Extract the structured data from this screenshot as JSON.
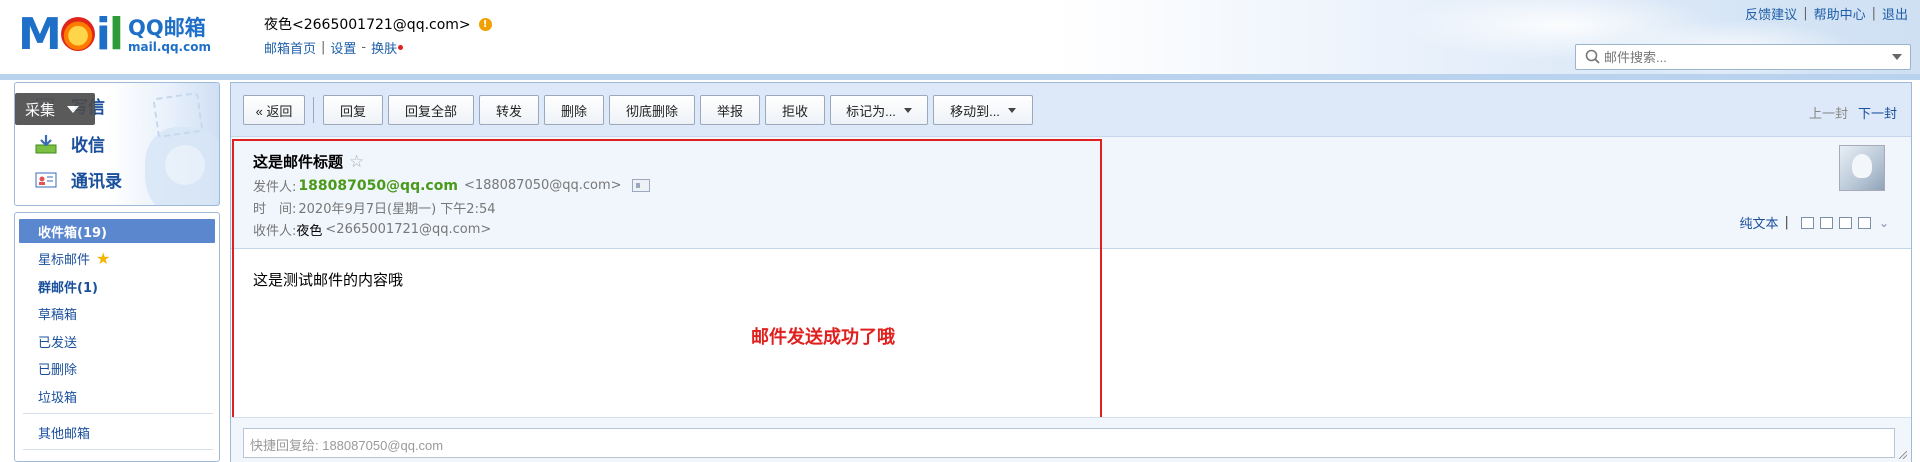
{
  "header": {
    "logo_brand": "MOil",
    "logo_name": "QQ邮箱",
    "logo_url": "mail.qq.com",
    "user_display": "夜色<2665001721@qq.com>",
    "links": [
      "邮箱首页",
      "设置",
      "换肤"
    ],
    "top_links": [
      "反馈建议",
      "帮助中心",
      "退出"
    ],
    "search_placeholder": "邮件搜索..."
  },
  "sidebar": {
    "write_label": "写信",
    "receive_label": "收信",
    "contacts_label": "通讯录",
    "overlay_label": "采集",
    "folders": [
      {
        "label": "收件箱(19)",
        "active": true
      },
      {
        "label": "星标邮件",
        "star": true
      },
      {
        "label": "群邮件(1)",
        "bold": true
      },
      {
        "label": "草稿箱"
      },
      {
        "label": "已发送"
      },
      {
        "label": "已删除"
      },
      {
        "label": "垃圾箱"
      },
      {
        "label": "其他邮箱"
      }
    ]
  },
  "toolbar": {
    "back": "« 返回",
    "reply": "回复",
    "reply_all": "回复全部",
    "forward": "转发",
    "delete": "删除",
    "delete_perm": "彻底删除",
    "report": "举报",
    "reject": "拒收",
    "mark_as": "标记为...",
    "move_to": "移动到...",
    "prev": "上一封",
    "next": "下一封"
  },
  "mail": {
    "subject": "这是邮件标题",
    "from_label": "发件人:",
    "from_name": "188087050@qq.com",
    "from_addr": "<188087050@qq.com>",
    "time_label": "时　间:",
    "time_value": "2020年9月7日(星期一) 下午2:54",
    "to_label": "收件人:",
    "to_name": "夜色",
    "to_addr": "<2665001721@qq.com>",
    "plain_text": "纯文本",
    "body": "这是测试邮件的内容哦",
    "annotation": "邮件发送成功了哦",
    "quick_reply_placeholder": "快捷回复给: 188087050@qq.com"
  },
  "colors": {
    "brand_blue": "#1e6fc8",
    "link_blue": "#1a4f9c",
    "active_folder": "#5b87cf",
    "sender_green": "#4a9a1a",
    "annotation_red": "#e0201e"
  }
}
